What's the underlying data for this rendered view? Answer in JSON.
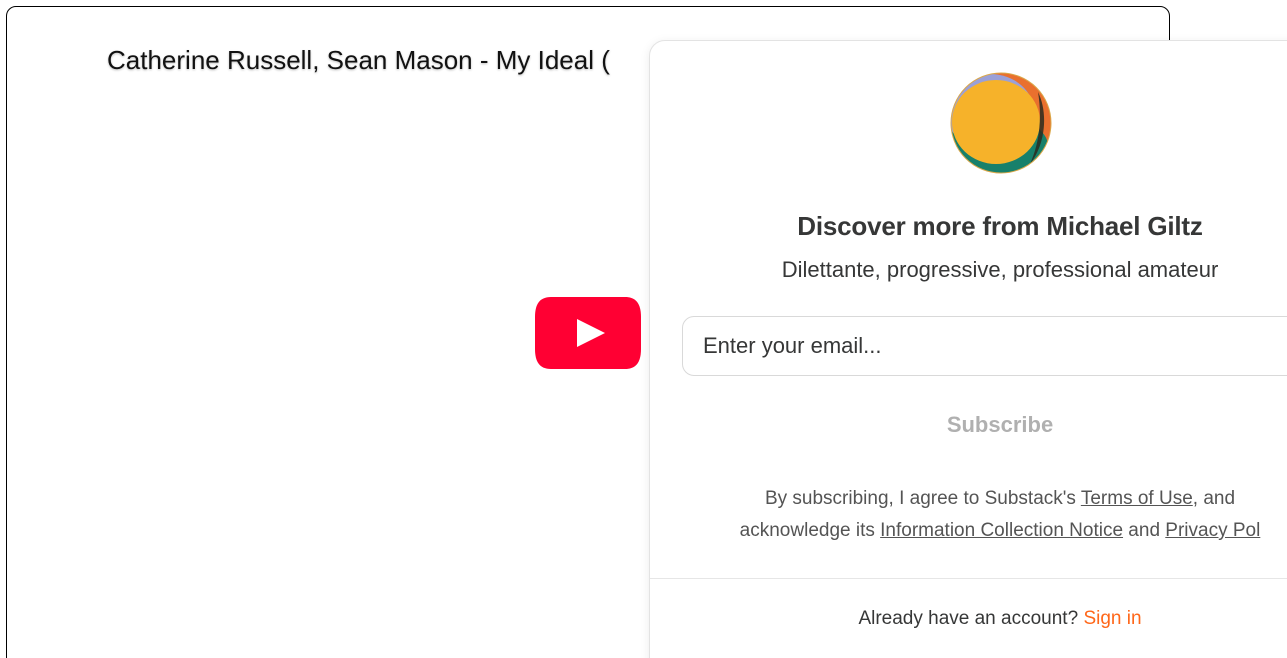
{
  "video": {
    "title": "Catherine Russell, Sean Mason - My Ideal (",
    "play_icon": "youtube-play-icon",
    "play_color": "#ff0033"
  },
  "modal": {
    "logo_icon": "publication-logo",
    "title": "Discover more from Michael Giltz",
    "subtitle": "Dilettante, progressive, professional amateur",
    "email_placeholder": "Enter your email...",
    "subscribe_label": "Subscribe",
    "legal": {
      "prefix": "By subscribing, I agree to Substack's ",
      "terms_link": "Terms of Use",
      "middle": ", and",
      "line2_prefix": "acknowledge its ",
      "info_link": "Information Collection Notice",
      "and": " and ",
      "privacy_link": "Privacy Pol"
    },
    "signin_prompt": "Already have an account? ",
    "signin_link": "Sign in",
    "accent_color": "#ff6719"
  }
}
